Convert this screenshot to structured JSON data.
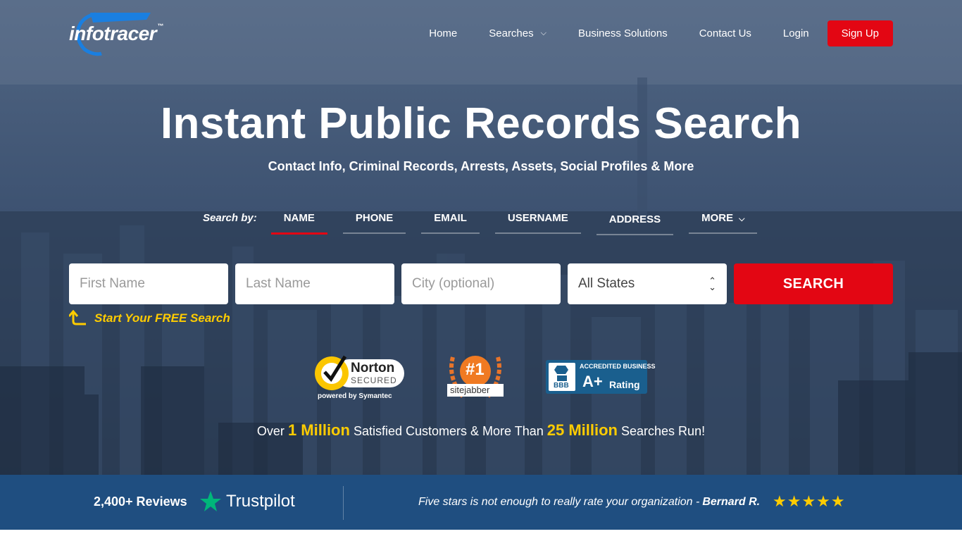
{
  "brand": {
    "logo_text": "infotracer",
    "trademark": "™"
  },
  "nav": {
    "items": [
      "Home",
      "Searches",
      "Business Solutions",
      "Contact Us",
      "Login"
    ],
    "signup": "Sign Up"
  },
  "hero": {
    "title": "Instant Public Records Search",
    "subtitle": "Contact Info, Criminal Records, Arrests, Assets, Social Profiles & More"
  },
  "search": {
    "by_label": "Search by:",
    "tabs": [
      "NAME",
      "PHONE",
      "EMAIL",
      "USERNAME",
      "ADDRESS",
      "MORE"
    ],
    "active_tab": "NAME",
    "first_name_placeholder": "First Name",
    "last_name_placeholder": "Last Name",
    "city_placeholder": "City (optional)",
    "state_value": "All States",
    "button": "SEARCH",
    "free_prompt": "Start Your FREE Search"
  },
  "badges": {
    "norton": {
      "name": "Norton",
      "secured": "SECURED",
      "powered": "powered by Symantec"
    },
    "sitejabber": {
      "rank": "#1",
      "name": "sitejabber"
    },
    "bbb": {
      "logo": "BBB",
      "accredited": "ACCREDITED BUSINESS",
      "grade": "A+",
      "rating": "Rating"
    }
  },
  "stats": {
    "pre": "Over",
    "customers": "1 Million",
    "mid": "Satisfied Customers & More Than",
    "searches": "25 Million",
    "post": "Searches Run!"
  },
  "reviews_bar": {
    "count": "2,400+ Reviews",
    "provider": "Trustpilot",
    "quote": "Five stars is not enough to really rate your organization -",
    "author": "Bernard R.",
    "stars": "★★★★★"
  },
  "colors": {
    "accent_red": "#e30613",
    "highlight_yellow": "#ffcc00",
    "bar_blue": "#1f4e80",
    "trustpilot_green": "#00b67a"
  }
}
